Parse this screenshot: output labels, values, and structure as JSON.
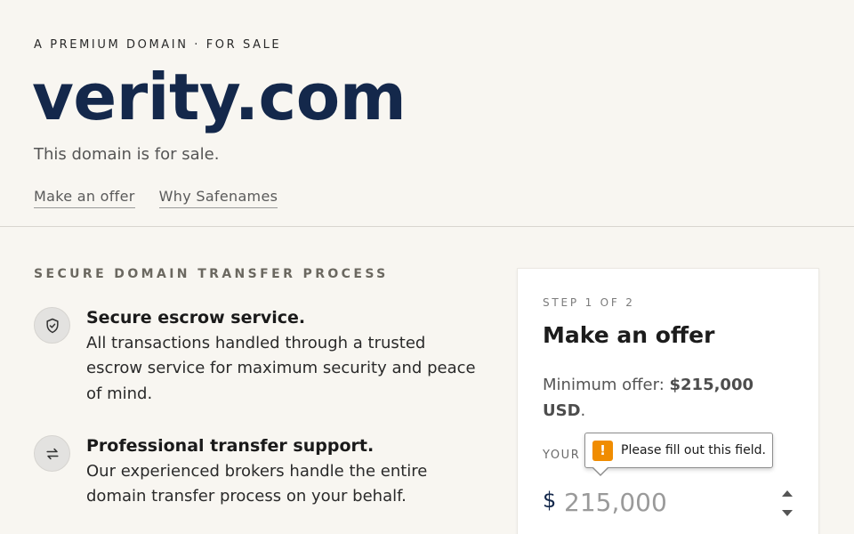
{
  "hero": {
    "eyebrow": "A PREMIUM DOMAIN · FOR SALE",
    "domain": "verity.com",
    "subtitle": "This domain is for sale.",
    "links": [
      "Make an offer",
      "Why Safenames"
    ]
  },
  "features": {
    "section_title": "SECURE DOMAIN TRANSFER PROCESS",
    "items": [
      {
        "icon": "shield-check-icon",
        "title": "Secure escrow service.",
        "description": "All transactions handled through a trusted escrow service for maximum security and peace of mind."
      },
      {
        "icon": "transfer-arrows-icon",
        "title": "Professional transfer support.",
        "description": "Our experienced brokers handle the entire domain transfer process on your behalf."
      }
    ]
  },
  "offer_card": {
    "step": "STEP 1 OF 2",
    "title": "Make an offer",
    "min_offer_prefix": "Minimum offer: ",
    "min_offer_amount": "$215,000 USD",
    "min_offer_suffix": ".",
    "label": "YOUR OFFER",
    "currency_symbol": "$",
    "input_placeholder": "215,000",
    "input_value": ""
  },
  "validation_tooltip": {
    "icon": "warning-icon",
    "message": "Please fill out this field."
  },
  "colors": {
    "background": "#f8f6f1",
    "brand_navy": "#14284b",
    "warning": "#f08c00"
  }
}
